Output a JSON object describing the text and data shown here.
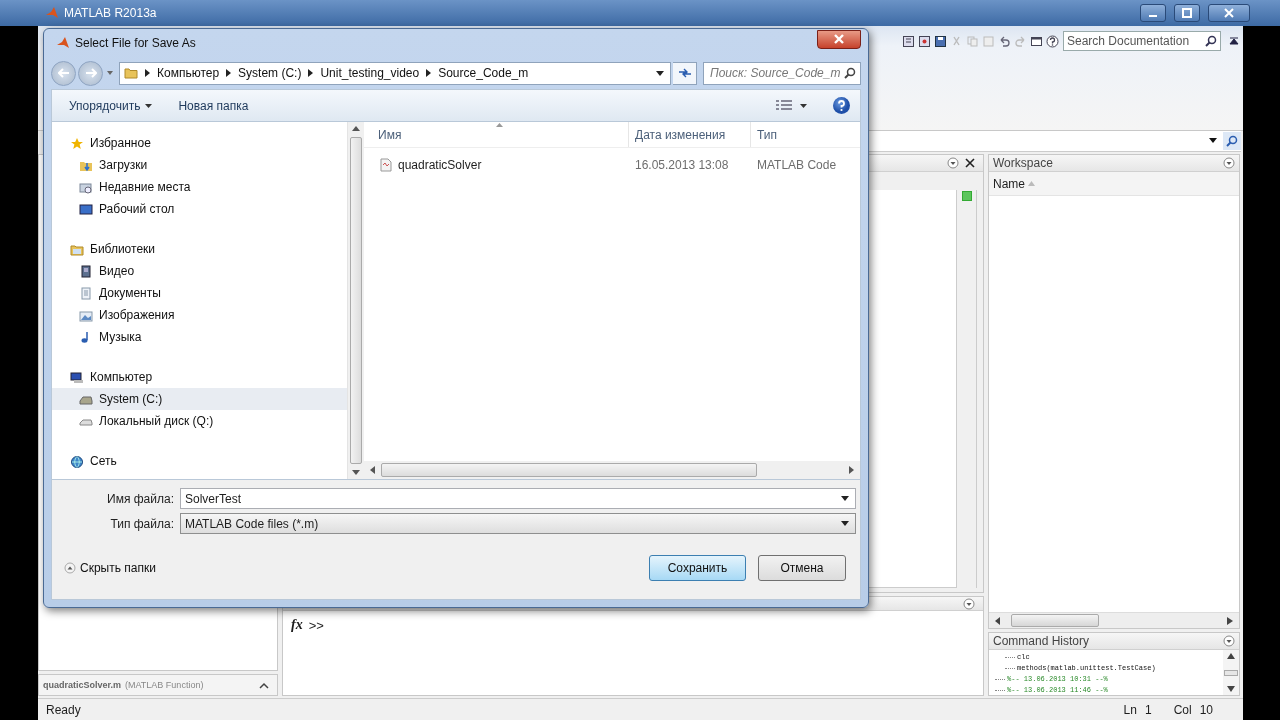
{
  "window": {
    "title": "MATLAB R2013a"
  },
  "toolstrip": {
    "search": {
      "placeholder": "Search Documentation"
    }
  },
  "current_folder": {
    "details": {
      "name": "quadraticSolver.m",
      "type": "(MATLAB Function)"
    }
  },
  "command_window": {
    "prompt": "fx",
    "text": ">>"
  },
  "workspace": {
    "title": "Workspace",
    "columns": [
      {
        "label": "Name"
      }
    ]
  },
  "command_history": {
    "title": "Command History",
    "entries": [
      {
        "kind": "command",
        "text": "clc"
      },
      {
        "kind": "command",
        "text": "methods(matlab.unittest.TestCase)"
      },
      {
        "kind": "session",
        "text": "%-- 13.06.2013 10:31 --%"
      },
      {
        "kind": "session",
        "text": "%-- 13.06.2013 11:46 --%"
      }
    ]
  },
  "status_bar": {
    "status": "Ready",
    "line_label": "Ln",
    "line": "1",
    "col_label": "Col",
    "col": "10"
  },
  "dialog": {
    "title": "Select File for Save As",
    "breadcrumbs": [
      "Компьютер",
      "System (C:)",
      "Unit_testing_video",
      "Source_Code_m"
    ],
    "search": {
      "placeholder": "Поиск: Source_Code_m"
    },
    "toolbar": [
      {
        "kind": "menu",
        "label": "Упорядочить"
      },
      {
        "kind": "plain",
        "label": "Новая папка"
      }
    ],
    "nav": [
      {
        "label": "Избранное",
        "selected": false,
        "children": [
          {
            "label": "Загрузки",
            "selected": false
          },
          {
            "label": "Недавние места",
            "selected": false
          },
          {
            "label": "Рабочий стол",
            "selected": false
          }
        ]
      },
      {
        "label": "Библиотеки",
        "selected": false,
        "children": [
          {
            "label": "Видео",
            "selected": false
          },
          {
            "label": "Документы",
            "selected": false
          },
          {
            "label": "Изображения",
            "selected": false
          },
          {
            "label": "Музыка",
            "selected": false
          }
        ]
      },
      {
        "label": "Компьютер",
        "selected": false,
        "children": [
          {
            "label": "System (C:)",
            "selected": true
          },
          {
            "label": "Локальный диск (Q:)",
            "selected": false
          }
        ]
      },
      {
        "label": "Сеть",
        "selected": false
      }
    ],
    "columns": [
      {
        "label": "Имя",
        "sorted": true
      },
      {
        "label": "Дата изменения",
        "sorted": false
      },
      {
        "label": "Тип",
        "sorted": false
      }
    ],
    "files": [
      {
        "name": "quadraticSolver",
        "modified": "16.05.2013 13:08",
        "type": "MATLAB Code"
      }
    ],
    "fields": [
      {
        "label": "Имя файла:",
        "value": "SolverTest"
      },
      {
        "label": "Тип файла:",
        "value": "MATLAB Code files (*.m)"
      }
    ],
    "hide_folders": "Скрыть папки",
    "buttons": [
      {
        "label": "Сохранить",
        "default": true
      },
      {
        "label": "Отмена",
        "default": false
      }
    ]
  }
}
